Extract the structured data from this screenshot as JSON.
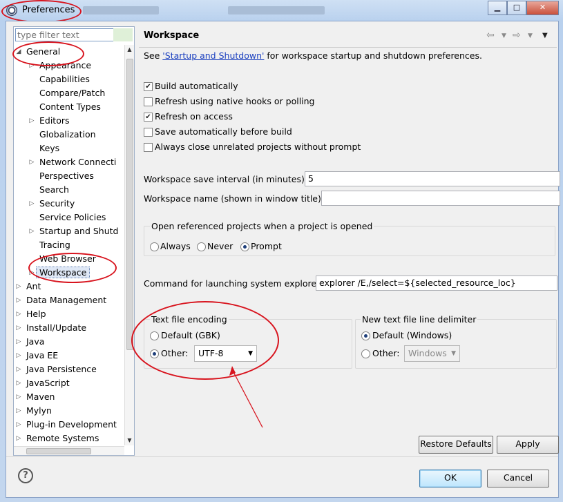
{
  "window": {
    "title": "Preferences",
    "minimize_glyph": "▁",
    "maximize_glyph": "□",
    "close_glyph": "✕",
    "icon": "eclipse-gear-icon"
  },
  "filter": {
    "placeholder": "type filter text"
  },
  "tree": {
    "general": "General",
    "general_children": [
      "Appearance",
      "Capabilities",
      "Compare/Patch",
      "Content Types",
      "Editors",
      "Globalization",
      "Keys",
      "Network Connecti",
      "Perspectives",
      "Search",
      "Security",
      "Service Policies",
      "Startup and Shutd",
      "Tracing",
      "Web Browser",
      "Workspace"
    ],
    "top_level": [
      "Ant",
      "Data Management",
      "Help",
      "Install/Update",
      "Java",
      "Java EE",
      "Java Persistence",
      "JavaScript",
      "Maven",
      "Mylyn",
      "Plug-in Development",
      "Remote Systems"
    ],
    "selected": "Workspace"
  },
  "page": {
    "title": "Workspace",
    "see_prefix": "See ",
    "see_link": "'Startup and Shutdown'",
    "see_suffix": " for workspace startup and shutdown preferences.",
    "checkboxes": [
      {
        "label": "Build automatically",
        "checked": true
      },
      {
        "label": "Refresh using native hooks or polling",
        "checked": false
      },
      {
        "label": "Refresh on access",
        "checked": true
      },
      {
        "label": "Save automatically before build",
        "checked": false
      },
      {
        "label": "Always close unrelated projects without prompt",
        "checked": false
      }
    ],
    "save_interval_label": "Workspace save interval (in minutes):",
    "save_interval_value": "5",
    "workspace_name_label": "Workspace name (shown in window title):",
    "workspace_name_value": "",
    "open_ref_group": "Open referenced projects when a project is opened",
    "open_ref_options": [
      "Always",
      "Never",
      "Prompt"
    ],
    "open_ref_selected": "Prompt",
    "explorer_label": "Command for launching system explorer:",
    "explorer_value": "explorer /E,/select=${selected_resource_loc}",
    "encoding_group": "Text file encoding",
    "encoding_default": "Default (GBK)",
    "encoding_other": "Other:",
    "encoding_value": "UTF-8",
    "delimiter_group": "New text file line delimiter",
    "delimiter_default": "Default (Windows)",
    "delimiter_other": "Other:",
    "delimiter_value": "Windows",
    "restore_defaults": "Restore Defaults",
    "apply": "Apply"
  },
  "footer": {
    "ok": "OK",
    "cancel": "Cancel",
    "help_glyph": "?"
  },
  "colors": {
    "annotation_red": "#d8141e",
    "link_blue": "#1a3fbf"
  }
}
